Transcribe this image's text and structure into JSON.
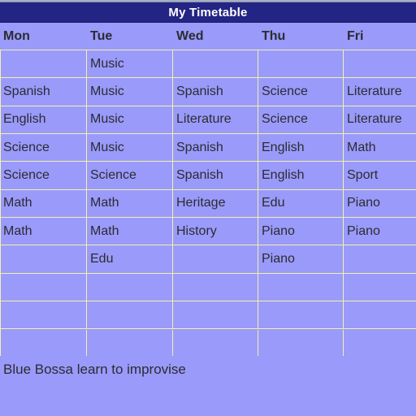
{
  "window": {
    "title": "My Timetable"
  },
  "theme": {
    "background": "#9a9afa",
    "titlebar_background": "#242484",
    "titlebar_text": "#ffffff",
    "gridline": "#f2f2a8",
    "text": "#2b2b33",
    "status_strip": "#a8aec4"
  },
  "table": {
    "columns": [
      {
        "label": "Mon"
      },
      {
        "label": "Tue"
      },
      {
        "label": "Wed"
      },
      {
        "label": "Thu"
      },
      {
        "label": "Fri"
      }
    ],
    "rows": [
      [
        "",
        "Music",
        "",
        "",
        ""
      ],
      [
        "Spanish",
        "Music",
        "Spanish",
        "Science",
        "Literature"
      ],
      [
        "English",
        "Music",
        "Literature",
        "Science",
        "Literature"
      ],
      [
        "Science",
        "Music",
        "Spanish",
        "English",
        "Math"
      ],
      [
        "Science",
        "Science",
        "Spanish",
        "English",
        "Sport"
      ],
      [
        "Math",
        "Math",
        "Heritage",
        "Edu",
        "Piano"
      ],
      [
        "Math",
        "Math",
        "History",
        "Piano",
        "Piano"
      ],
      [
        "",
        "Edu",
        "",
        "Piano",
        ""
      ],
      [
        "",
        "",
        "",
        "",
        ""
      ],
      [
        "",
        "",
        "",
        "",
        ""
      ],
      [
        "",
        "",
        "",
        "",
        ""
      ]
    ]
  },
  "footer": {
    "note": "Blue Bossa learn to improvise"
  }
}
